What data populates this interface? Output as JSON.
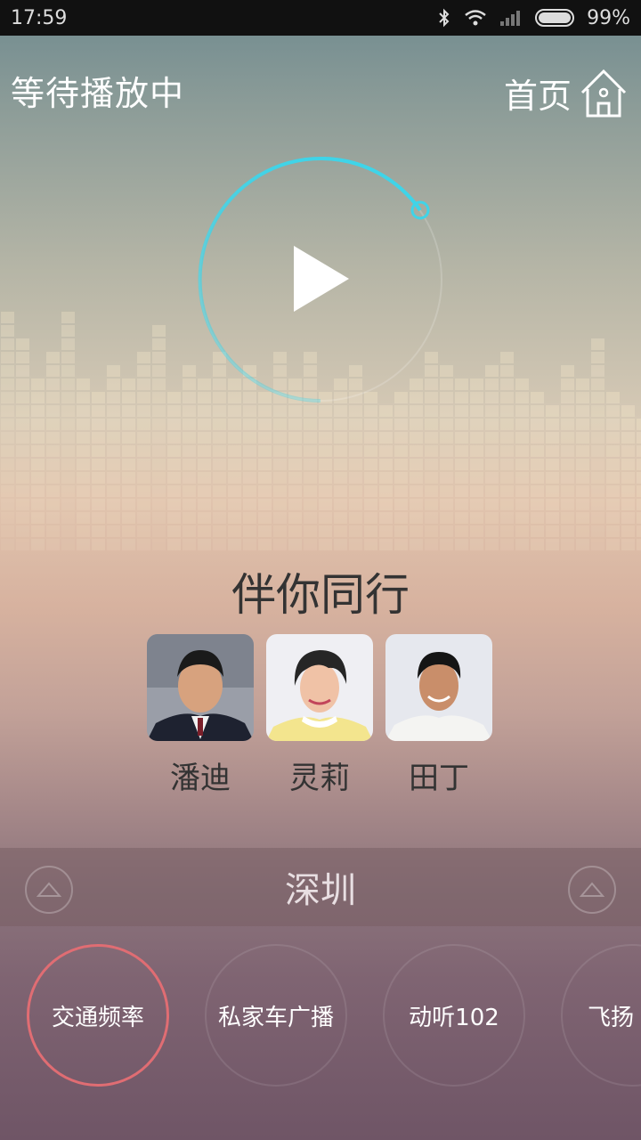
{
  "status_bar": {
    "time": "17:59",
    "battery_text": "99%",
    "icons": [
      "bluetooth-icon",
      "wifi-icon",
      "signal-icon",
      "battery-icon"
    ]
  },
  "header": {
    "title": "等待播放中",
    "home_label": "首页"
  },
  "player": {
    "state": "paused",
    "ring_color": "#3fd4e8"
  },
  "show": {
    "title": "伴你同行",
    "hosts": [
      {
        "name": "潘迪"
      },
      {
        "name": "灵莉"
      },
      {
        "name": "田丁"
      }
    ]
  },
  "city": {
    "name": "深圳"
  },
  "stations": [
    {
      "name": "交通频率",
      "active": true
    },
    {
      "name": "私家车广播",
      "active": false
    },
    {
      "name": "动听102",
      "active": false
    },
    {
      "name": "飞扬",
      "active": false
    }
  ],
  "colors": {
    "accent_ring": "#3fd4e8",
    "active_station_ring": "#e06d73"
  }
}
